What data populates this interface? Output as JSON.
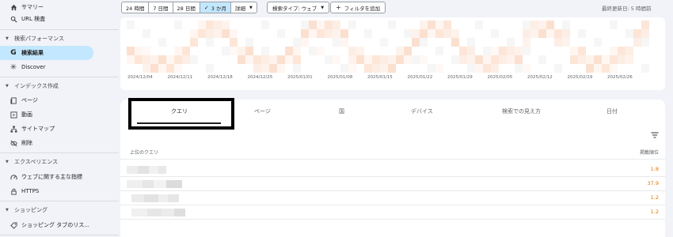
{
  "sidebar": {
    "items_top": [
      {
        "label": "サマリー",
        "icon": "home-icon"
      },
      {
        "label": "URL 検査",
        "icon": "search-icon"
      }
    ],
    "sections": [
      {
        "label": "検索パフォーマンス",
        "items": [
          {
            "label": "検索結果",
            "icon": "google-g-icon",
            "active": true
          },
          {
            "label": "Discover",
            "icon": "asterisk-icon"
          }
        ]
      },
      {
        "label": "インデックス作成",
        "items": [
          {
            "label": "ページ",
            "icon": "pages-icon"
          },
          {
            "label": "動画",
            "icon": "video-icon"
          },
          {
            "label": "サイトマップ",
            "icon": "sitemap-icon"
          },
          {
            "label": "削除",
            "icon": "eye-off-icon"
          }
        ]
      },
      {
        "label": "エクスペリエンス",
        "items": [
          {
            "label": "ウェブに関する主な指標",
            "icon": "speed-icon"
          },
          {
            "label": "HTTPS",
            "icon": "lock-icon"
          }
        ]
      },
      {
        "label": "ショッピング",
        "items": [
          {
            "label": "ショッピング タブのリス...",
            "icon": "tag-icon"
          }
        ]
      }
    ]
  },
  "toolbar": {
    "date_ranges": [
      "24 時間",
      "7 日間",
      "28 日間",
      "3 か月",
      "詳細"
    ],
    "selected_range": "3 か月",
    "search_type": "検索タイプ: ウェブ",
    "add_filter": "フィルタを追加",
    "last_updated": "最終更新日: 5 時間前"
  },
  "chart": {
    "x_labels": [
      "2024/12/04",
      "2024/12/11",
      "2024/12/18",
      "2024/12/25",
      "2025/01/01",
      "2025/01/08",
      "2025/01/15",
      "2025/01/22",
      "2025/01/29",
      "2025/02/05",
      "2025/02/12",
      "2025/02/19",
      "2025/02/26"
    ]
  },
  "table": {
    "tabs": [
      "クエリ",
      "ページ",
      "国",
      "デバイス",
      "検索での見え方",
      "日付"
    ],
    "active_tab": "クエリ",
    "column_query": "上位のクエリ",
    "column_position": "掲載順位",
    "rows": [
      {
        "position": "1.8"
      },
      {
        "position": "37.9"
      },
      {
        "position": "1.2"
      },
      {
        "position": "1.2"
      }
    ]
  },
  "colors": {
    "accent": "#c2e7ff",
    "position_text": "#e37400",
    "chart_blocks": "#fde6d8"
  }
}
